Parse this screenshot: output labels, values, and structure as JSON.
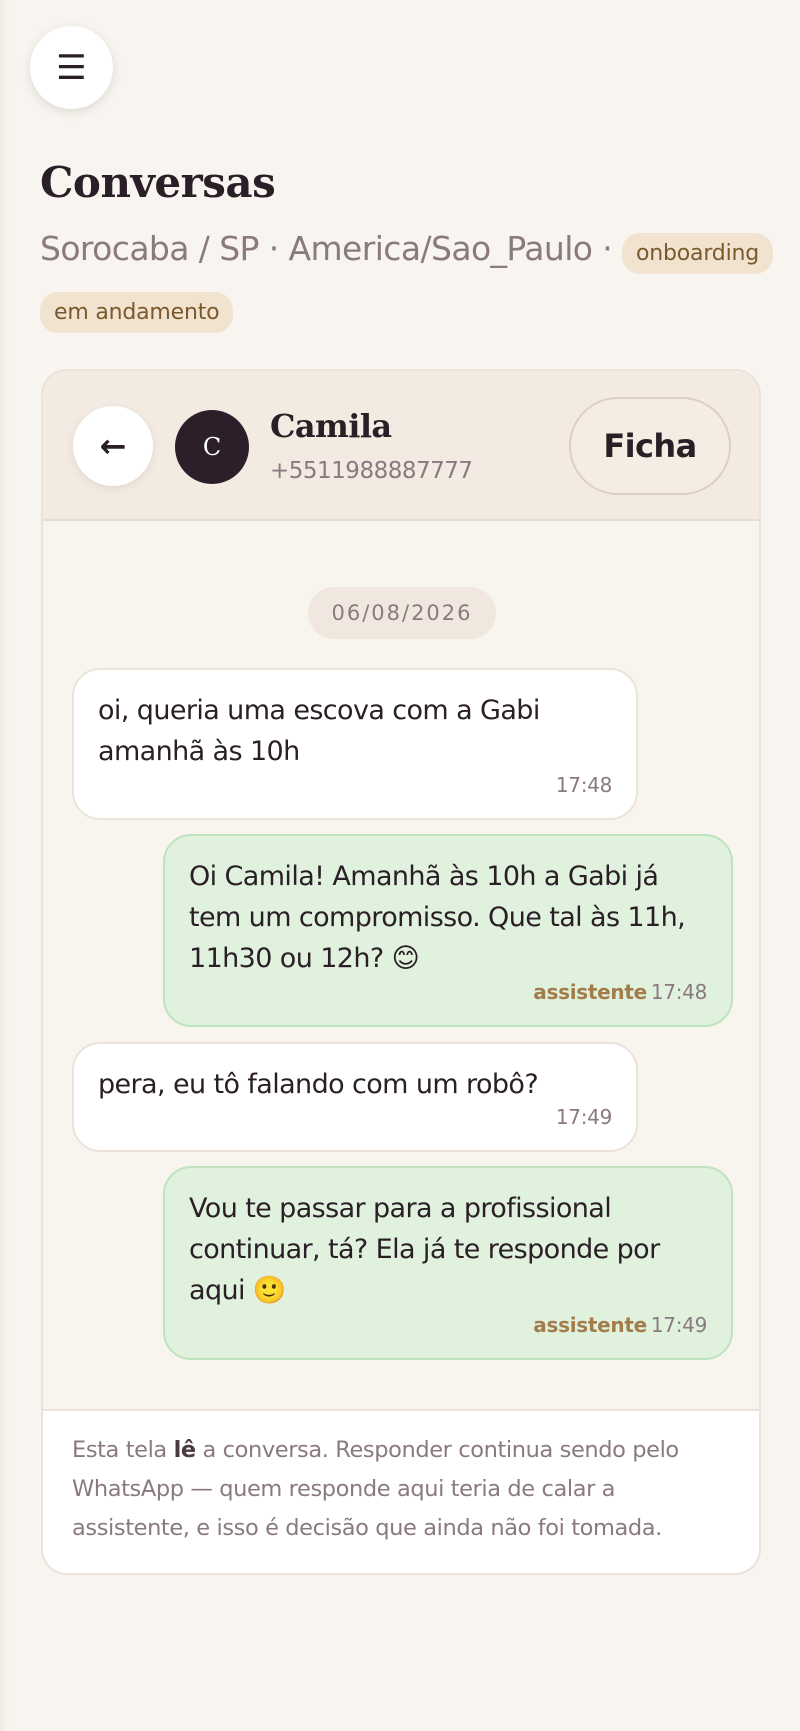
{
  "menu": {
    "icon": "hamburger-menu-icon",
    "glyph": "☰"
  },
  "page": {
    "title": "Conversas",
    "location": "Sorocaba / SP",
    "separator": " · ",
    "timezone": "America/Sao_Paulo",
    "status_badge": "onboarding em andamento"
  },
  "chat": {
    "header": {
      "back_icon": "arrow-left-icon",
      "back_glyph": "←",
      "avatar_initial": "C",
      "contact_name": "Camila",
      "contact_phone": "+5511988887777",
      "ficha_label": "Ficha"
    },
    "date_label": "06/08/2026",
    "messages": [
      {
        "direction": "in",
        "text": "oi, queria uma escova com a Gabi amanhã às 10h",
        "time": "17:48",
        "sender": ""
      },
      {
        "direction": "out",
        "text": "Oi Camila! Amanhã às 10h a Gabi já tem um compromisso. Que tal às 11h, 11h30 ou 12h? 😊",
        "time": "17:48",
        "sender": "assistente"
      },
      {
        "direction": "in",
        "text": "pera, eu tô falando com um robô?",
        "time": "17:49",
        "sender": ""
      },
      {
        "direction": "out",
        "text": "Vou te passar para a profissional continuar, tá? Ela já te responde por aqui 🙂",
        "time": "17:49",
        "sender": "assistente"
      }
    ],
    "footer": {
      "before_bold": "Esta tela ",
      "bold": "lê",
      "after_bold": " a conversa. Responder continua sendo pelo WhatsApp — quem responde aqui teria de calar a assistente, e isso é decisão que ainda não foi tomada."
    }
  },
  "colors": {
    "background": "#f8f5f0",
    "avatar": "#2c1f29",
    "outgoing_bubble": "#e0f1de",
    "incoming_bubble": "#ffffff",
    "badge": "#f1e3cf",
    "assistant_label": "#a27d4b"
  }
}
